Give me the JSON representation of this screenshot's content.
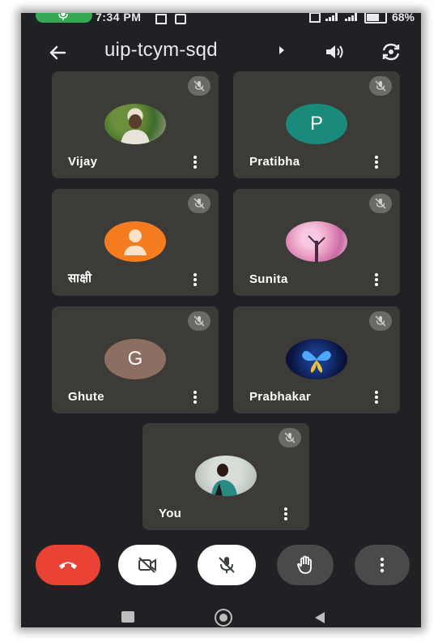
{
  "status": {
    "time": "7:34 PM",
    "battery": "68%"
  },
  "topbar": {
    "meeting_code": "uip-tcym-sqd"
  },
  "participants": [
    {
      "name": "Vijay",
      "avatar": "photo",
      "muted": true
    },
    {
      "name": "Pratibha",
      "avatar_letter": "P",
      "avatar_color": "#1a8a7c",
      "muted": true
    },
    {
      "name": "साक्षी",
      "avatar": "default-person",
      "avatar_color": "#f57c1f",
      "muted": true
    },
    {
      "name": "Sunita",
      "avatar": "photo",
      "muted": true
    },
    {
      "name": "Ghute",
      "avatar_letter": "G",
      "avatar_color": "#8d6e63",
      "muted": true
    },
    {
      "name": "Prabhakar",
      "avatar": "photo",
      "muted": true
    },
    {
      "name": "You",
      "avatar": "photo",
      "muted": true
    }
  ],
  "controls": {
    "end_call_color": "#ea4335",
    "camera_off_bg": "#ffffff",
    "mic_off_bg": "#ffffff",
    "raise_hand_bg": "#4a4a4a",
    "more_bg": "#4a4a4a"
  },
  "icons": {
    "back": "arrow-left-icon",
    "speaker": "speaker-icon",
    "switch_camera": "switch-camera-icon",
    "mute": "mic-off-icon",
    "end_call": "phone-hangup-icon",
    "camera_off": "video-off-icon",
    "hand": "raise-hand-icon",
    "more": "more-vert-icon"
  }
}
